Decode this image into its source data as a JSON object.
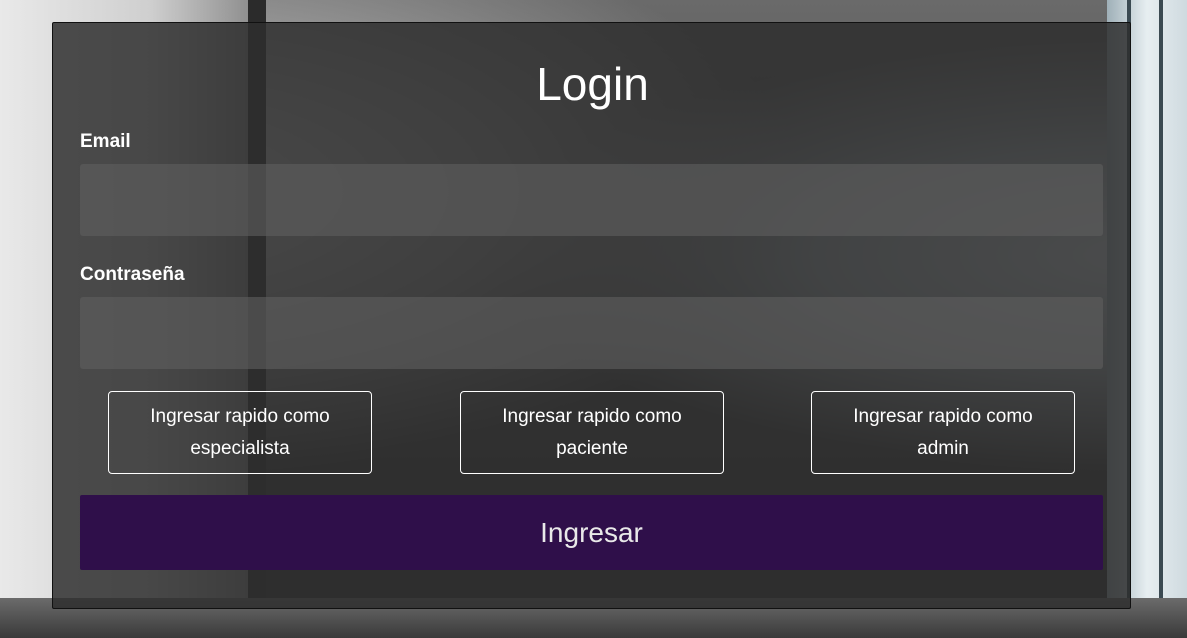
{
  "login": {
    "title": "Login",
    "email_label": "Email",
    "email_value": "",
    "password_label": "Contraseña",
    "password_value": "",
    "quick_buttons": [
      {
        "label": "Ingresar rapido como especialista"
      },
      {
        "label": "Ingresar rapido como paciente"
      },
      {
        "label": "Ingresar rapido como admin"
      }
    ],
    "submit_label": "Ingresar"
  },
  "colors": {
    "panel": "#2d2d2d",
    "field": "#5f5f5f",
    "submit": "#2f0f4a",
    "text": "#ffffff"
  }
}
